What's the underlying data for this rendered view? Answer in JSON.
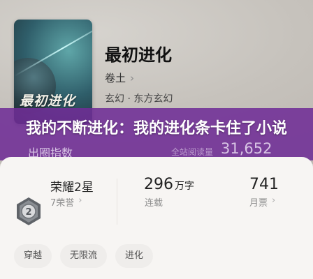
{
  "book": {
    "cover_title": "最初进化",
    "title": "最初进化",
    "author": "卷土",
    "author_chevron": "›",
    "genre": "玄幻 · 东方玄幻"
  },
  "banner": {
    "headline": "我的不断进化：我的进化条卡住了小说"
  },
  "stats_bar": {
    "left_label": "出圈指数",
    "right_label": "全站阅读量",
    "right_value": "31,652"
  },
  "info": {
    "honor_title": "荣耀2星",
    "honor_sub": "7荣誉",
    "honor_chevron": "›",
    "words_value": "296",
    "words_unit": "万字",
    "words_label": "连载",
    "tickets_value": "741",
    "tickets_label": "月票",
    "tickets_chevron": "›",
    "medal_number": "2"
  },
  "tags": [
    "穿越",
    "无限流",
    "进化"
  ]
}
